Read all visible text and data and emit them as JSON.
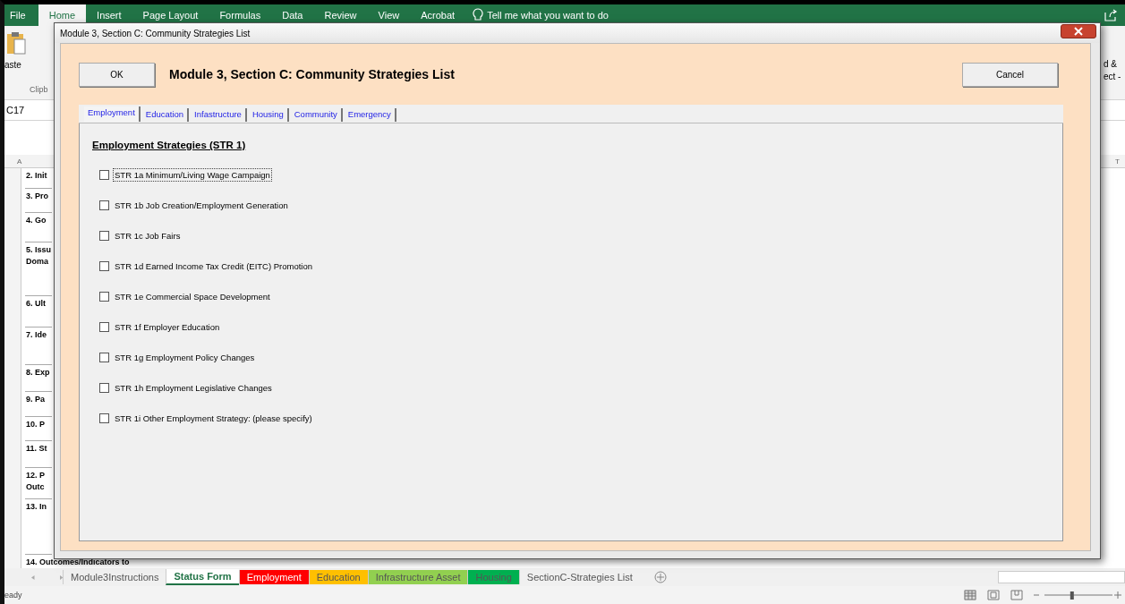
{
  "excel": {
    "ribbon_tabs": [
      {
        "label": "File",
        "selected": false
      },
      {
        "label": "Home",
        "selected": true
      },
      {
        "label": "Insert",
        "selected": false
      },
      {
        "label": "Page Layout",
        "selected": false
      },
      {
        "label": "Formulas",
        "selected": false
      },
      {
        "label": "Data",
        "selected": false
      },
      {
        "label": "Review",
        "selected": false
      },
      {
        "label": "View",
        "selected": false
      },
      {
        "label": "Acrobat",
        "selected": false
      }
    ],
    "tell_me": "Tell me what you want to do",
    "paste_label": "aste",
    "clipboard_group": "Clipb",
    "right_fragments": [
      "d &",
      "ect -"
    ],
    "name_box": "C17",
    "column_headers": [
      "A",
      "T"
    ],
    "row_labels": [
      [
        "2. Init"
      ],
      [
        "3. Pro"
      ],
      [
        "4. Go"
      ],
      [
        "5. Issu",
        "Doma"
      ],
      [
        "6. Ult"
      ],
      [
        "7. Ide"
      ],
      [
        "8. Exp"
      ],
      [
        "9. Pa"
      ],
      [
        "10. P"
      ],
      [
        "11. St"
      ],
      [
        "12. P",
        "Outc"
      ],
      [
        "13. In"
      ]
    ],
    "bottom_row_label": "14. Outcomes/Indicators to",
    "sheet_tabs": [
      {
        "label": "Module3Instructions",
        "selected": false
      },
      {
        "label": "Status Form",
        "selected": true
      },
      {
        "label": "Employment",
        "selected": false,
        "color": "#ff0000"
      },
      {
        "label": "Education",
        "selected": false,
        "color": "#ffc000"
      },
      {
        "label": "Infrastructure Asset",
        "selected": false,
        "color": "#92d050"
      },
      {
        "label": "Housing",
        "selected": false,
        "color": "#00b050"
      },
      {
        "label": "SectionC-Strategies List",
        "selected": false
      }
    ],
    "status": "eady",
    "zoom_slider": {
      "level": 0.4
    }
  },
  "dialog": {
    "title": "Module 3, Section C: Community Strategies List",
    "ok": "OK",
    "heading": "Module 3, Section C: Community Strategies List",
    "cancel": "Cancel",
    "tabs": [
      {
        "label": "Employment",
        "selected": true
      },
      {
        "label": "Education",
        "selected": false
      },
      {
        "label": "Infastructure",
        "selected": false
      },
      {
        "label": "Housing",
        "selected": false
      },
      {
        "label": "Community",
        "selected": false
      },
      {
        "label": "Emergency",
        "selected": false
      }
    ],
    "section_heading": "Employment Strategies (STR 1)",
    "options": [
      {
        "label": "STR 1a Minimum/Living Wage Campaign",
        "checked": false,
        "focused": true
      },
      {
        "label": "STR 1b Job Creation/Employment Generation",
        "checked": false,
        "focused": false
      },
      {
        "label": "STR 1c Job Fairs",
        "checked": false,
        "focused": false
      },
      {
        "label": "STR 1d Earned Income Tax Credit (EITC) Promotion",
        "checked": false,
        "focused": false
      },
      {
        "label": "STR 1e Commercial Space Development",
        "checked": false,
        "focused": false
      },
      {
        "label": "STR 1f Employer Education",
        "checked": false,
        "focused": false
      },
      {
        "label": "STR 1g Employment Policy Changes",
        "checked": false,
        "focused": false
      },
      {
        "label": "STR 1h Employment Legislative Changes",
        "checked": false,
        "focused": false
      },
      {
        "label": "STR 1i Other Employment Strategy: (please specify)",
        "checked": false,
        "focused": false
      }
    ]
  }
}
